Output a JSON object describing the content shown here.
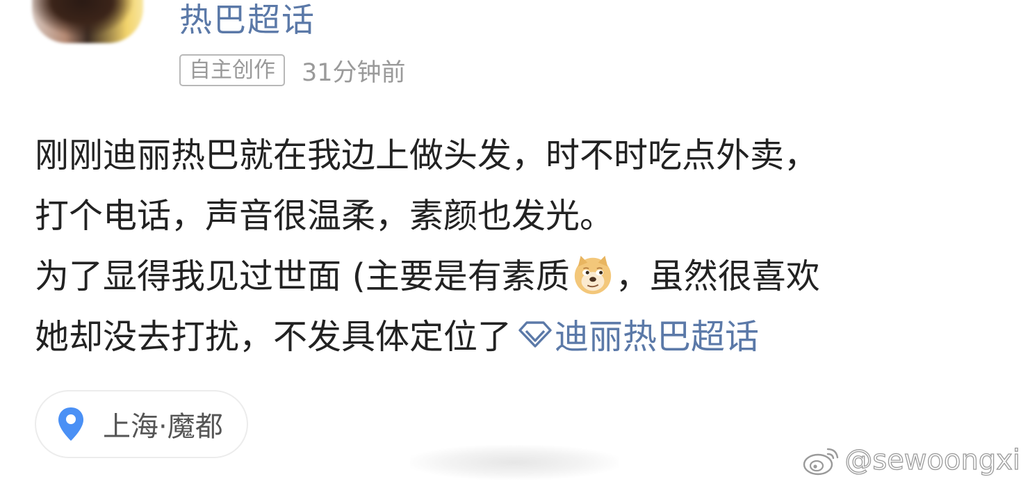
{
  "header": {
    "topic_title": "热巴超话",
    "tag_label": "自主创作",
    "time_ago": "31分钟前"
  },
  "post": {
    "line1": "刚刚迪丽热巴就在我边上做头发，时不时吃点外卖，",
    "line2": "打个电话，声音很温柔，素颜也发光。",
    "line3_before_emoji": "为了显得我见过世面 (主要是有素质",
    "line3_after_emoji": "，虽然很喜欢",
    "line4_text": "她却没去打扰，不发具体定位了",
    "topic_link": "迪丽热巴超话",
    "emoji_icon": "doge-emoji-icon",
    "topic_icon": "diamond-icon"
  },
  "location": {
    "label": "上海·魔都",
    "icon": "location-pin-icon",
    "pin_color": "#4a90f5"
  },
  "watermark": {
    "text": "@sewoongxi",
    "icon": "weibo-logo-icon"
  },
  "colors": {
    "link": "#5b79a8",
    "text": "#222222",
    "muted": "#9a9a9a"
  }
}
